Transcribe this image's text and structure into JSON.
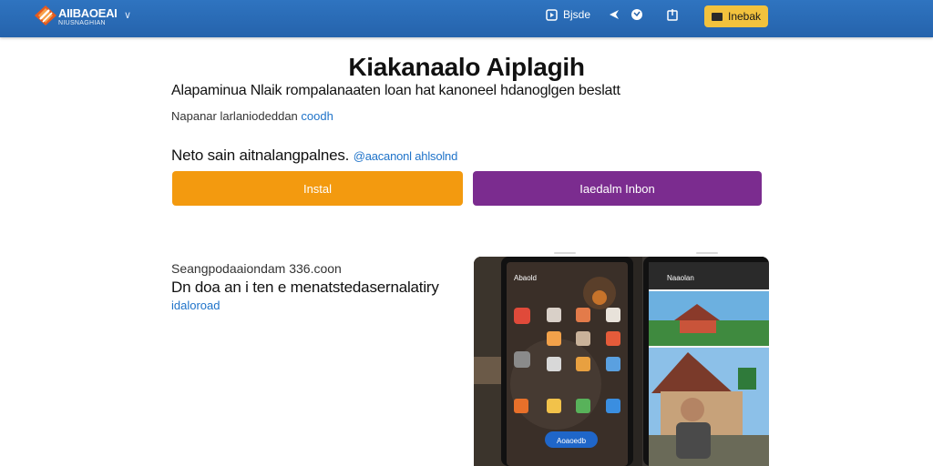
{
  "header": {
    "brand_line1": "AIIBAOEAI",
    "brand_line2": "NIUSNAGHIAN",
    "nav": [
      {
        "label": "Bjsde",
        "icon": "square-play-icon"
      },
      {
        "label": "",
        "icon": "arrow-icon"
      },
      {
        "label": "",
        "icon": "globe-icon"
      },
      {
        "label": "",
        "icon": "share-icon"
      }
    ],
    "cta_label": "Inebak",
    "accent": "#2563ac",
    "cta_color": "#f2c23d"
  },
  "main": {
    "title": "Kiakanaalo Aiplagih",
    "lead": "Alapaminua Nlaik rompalanaaten loan hat kanoneel hdanoglgen beslatt",
    "sub_text": "Napanar larlaniodeddan",
    "sub_link": "coodh",
    "cta_line": "Neto sain aitnalangpalnes.",
    "cta_link": "@aacanonl ahlsolnd",
    "install_label": "Instal",
    "learn_label": "Iaedalm Inbon",
    "install_color": "#f39a0f",
    "learn_color": "#7b2c8f"
  },
  "secondary": {
    "small": "Seangpodaaiondam 336.coon",
    "heading": "Dn doa an i ten e menatstedasernalatiry",
    "link": "idaloroad"
  },
  "preview": {
    "phone_left_title": "Abaold",
    "phone_right_title": "Naaolan",
    "phone_button": "Aoaoedb"
  }
}
